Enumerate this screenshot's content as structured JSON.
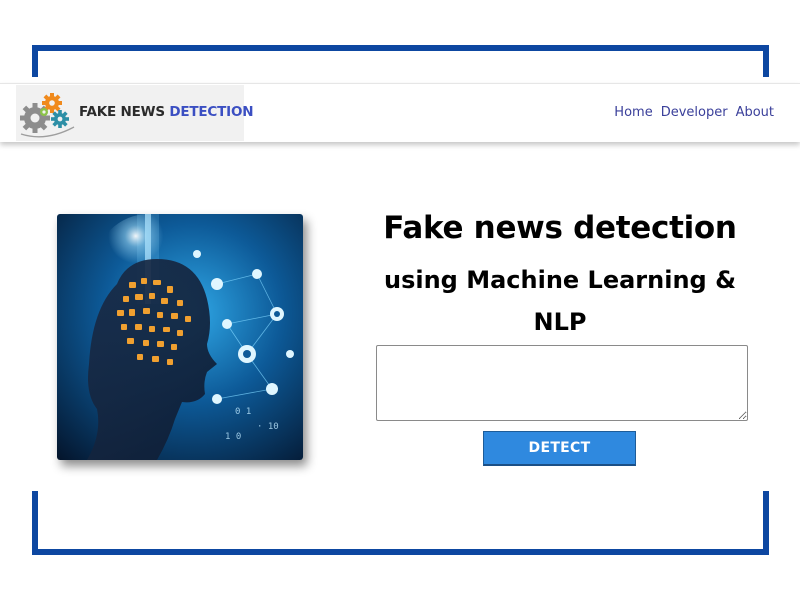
{
  "logo": {
    "brand_word1": "FAKE NEWS ",
    "brand_word2": "DETECTION",
    "icon": "gears-icon"
  },
  "nav": {
    "items": [
      {
        "label": "Home"
      },
      {
        "label": "Developer"
      },
      {
        "label": "About"
      }
    ]
  },
  "hero": {
    "image": "ai-head-network-illustration"
  },
  "main": {
    "title": "Fake news detection",
    "subtitle": "using Machine Learning & NLP",
    "textarea_value": "",
    "detect_label": "DETECT"
  },
  "colors": {
    "frame": "#0d47a1",
    "nav_link": "#3a3f9a",
    "logo_accent": "#3b4fc2",
    "button": "#2f89df"
  }
}
